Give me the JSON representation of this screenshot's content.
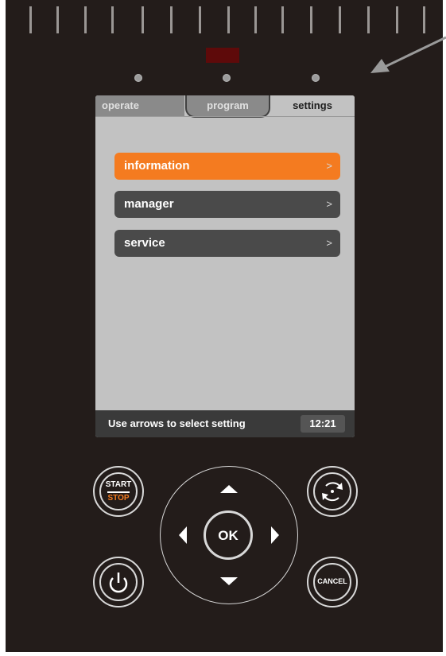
{
  "tabs": {
    "operate": "operate",
    "program": "program",
    "settings": "settings"
  },
  "menu": {
    "items": [
      {
        "label": "information",
        "chevron": ">",
        "state": "selected"
      },
      {
        "label": "manager",
        "chevron": ">",
        "state": "normal"
      },
      {
        "label": "service",
        "chevron": ">",
        "state": "normal"
      }
    ]
  },
  "status": {
    "hint": "Use arrows to select setting",
    "time": "12:21"
  },
  "controls": {
    "start_label": "START",
    "stop_label": "STOP",
    "ok_label": "OK",
    "cancel_label": "CANCEL"
  },
  "colors": {
    "accent": "#f47b20",
    "panel": "#231c1a",
    "screen": "#c2c2c2",
    "menu_item": "#4a4a4a"
  },
  "icons": [
    "power-icon",
    "refresh-icon",
    "arrow-up-icon",
    "arrow-down-icon",
    "arrow-left-icon",
    "arrow-right-icon"
  ]
}
